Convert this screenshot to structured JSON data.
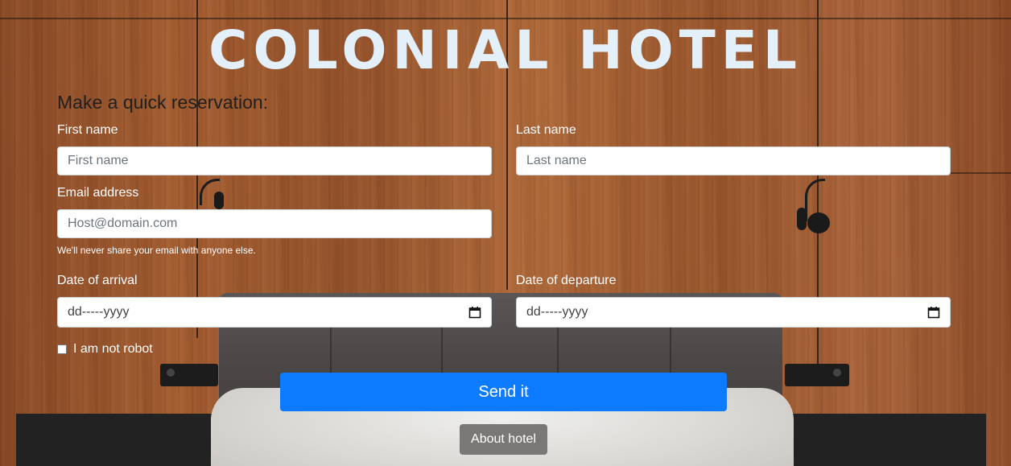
{
  "hotel_title": "COLONIAL HOTEL",
  "form": {
    "heading": "Make a quick reservation:",
    "first_name": {
      "label": "First name",
      "placeholder": "First name"
    },
    "last_name": {
      "label": "Last name",
      "placeholder": "Last name"
    },
    "email": {
      "label": "Email address",
      "placeholder": "Host@domain.com",
      "help": "We'll never share your email with anyone else."
    },
    "arrival": {
      "label": "Date of arrival",
      "value": "dd-----yyyy"
    },
    "departure": {
      "label": "Date of departure",
      "value": "dd-----yyyy"
    },
    "robot_check": {
      "label": "I am not robot",
      "checked": false
    },
    "send_label": "Send it",
    "about_label": "About hotel"
  },
  "icons": {
    "calendar": "calendar-icon"
  },
  "colors": {
    "primary_button": "#0d7bff",
    "secondary_button": "#7a7877",
    "title": "#e3f0fa"
  }
}
